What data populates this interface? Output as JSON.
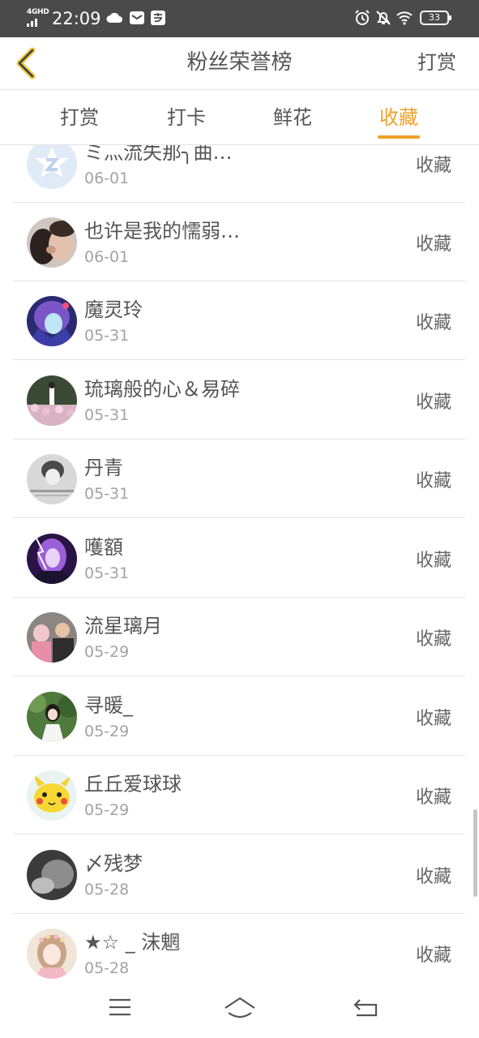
{
  "status_bar": {
    "network": "4GHD",
    "time": "22:09",
    "battery": "33"
  },
  "header": {
    "title": "粉丝荣誉榜",
    "action_label": "打赏"
  },
  "tabs": [
    {
      "label": "打赏",
      "active": false
    },
    {
      "label": "打卡",
      "active": false
    },
    {
      "label": "鲜花",
      "active": false
    },
    {
      "label": "收藏",
      "active": true
    }
  ],
  "colors": {
    "accent": "#f0a02a",
    "status_bar": "#4a4a4a",
    "text": "#555555",
    "muted": "#a3a3a3"
  },
  "list": [
    {
      "name": "ミ灬流失那╮曲…",
      "date": "06-01",
      "action": "收藏",
      "avatar": "default-avatar-icon"
    },
    {
      "name": "也许是我的懦弱…",
      "date": "06-01",
      "action": "收藏",
      "avatar": "couple-photo-avatar"
    },
    {
      "name": "魔灵玲",
      "date": "05-31",
      "action": "收藏",
      "avatar": "anime-girl-avatar"
    },
    {
      "name": "琉璃般的心＆易碎",
      "date": "05-31",
      "action": "收藏",
      "avatar": "flower-field-avatar"
    },
    {
      "name": "丹青",
      "date": "05-31",
      "action": "收藏",
      "avatar": "grayscale-portrait-avatar"
    },
    {
      "name": "嚄額",
      "date": "05-31",
      "action": "收藏",
      "avatar": "purple-lightning-avatar"
    },
    {
      "name": "流星璃月",
      "date": "05-29",
      "action": "收藏",
      "avatar": "family-photo-avatar"
    },
    {
      "name": "寻暖_",
      "date": "05-29",
      "action": "收藏",
      "avatar": "girl-outdoor-avatar"
    },
    {
      "name": "丘丘爱球球",
      "date": "05-29",
      "action": "收藏",
      "avatar": "pikachu-avatar"
    },
    {
      "name": "〆残梦",
      "date": "05-28",
      "action": "收藏",
      "avatar": "dark-gray-avatar"
    },
    {
      "name": "★☆ _ 沫魍",
      "date": "05-28",
      "action": "收藏",
      "avatar": "girl-flower-crown-avatar"
    }
  ],
  "navbar": {
    "menu": "menu-icon",
    "home": "home-icon",
    "back": "back-arrow-icon"
  }
}
